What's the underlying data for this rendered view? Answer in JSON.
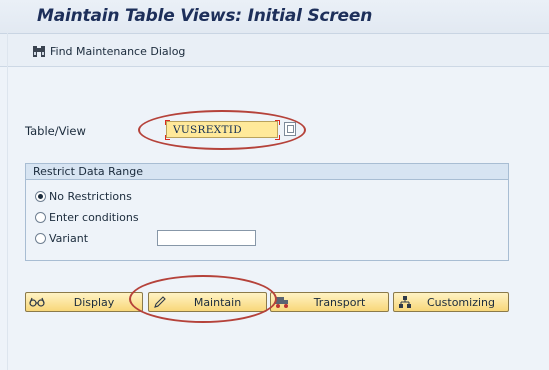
{
  "window": {
    "title": "Maintain Table Views: Initial Screen"
  },
  "toolbar": {
    "find_label": "Find Maintenance Dialog",
    "find_icon": "binoculars-icon"
  },
  "table_view": {
    "label": "Table/View",
    "value": "VUSREXTID"
  },
  "restrict": {
    "title": "Restrict Data Range",
    "options": [
      {
        "label": "No Restrictions",
        "selected": true
      },
      {
        "label": "Enter conditions",
        "selected": false
      },
      {
        "label": "Variant",
        "selected": false
      }
    ],
    "variant_value": ""
  },
  "buttons": [
    {
      "label": "Display",
      "icon": "glasses-icon"
    },
    {
      "label": "Maintain",
      "icon": "pencil-icon"
    },
    {
      "label": "Transport",
      "icon": "truck-icon"
    },
    {
      "label": "Customizing",
      "icon": "hierarchy-icon"
    }
  ],
  "colors": {
    "highlight_oval": "#b5423a",
    "button_fill": "#f8d77a",
    "input_fill": "#ffe99a",
    "title_text": "#1d2f5a"
  }
}
